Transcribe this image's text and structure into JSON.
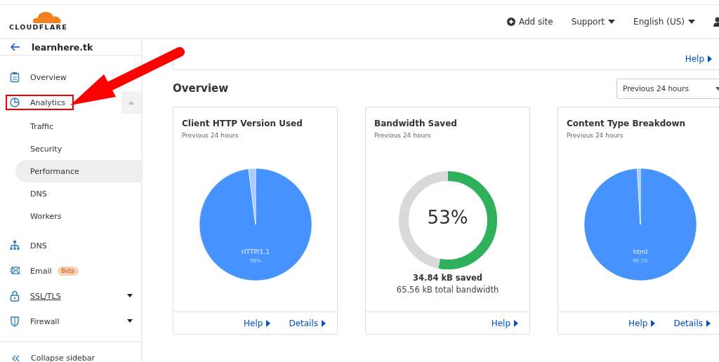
{
  "header": {
    "logo": "CLOUDFLARE",
    "actions": [
      {
        "kind": "add",
        "label": "Add site"
      },
      {
        "kind": "menu",
        "label": "Support"
      },
      {
        "kind": "menu",
        "label": "English (US)"
      },
      {
        "kind": "user"
      }
    ]
  },
  "sidebar": {
    "site": "learnhere.tk",
    "items": [
      {
        "label": "Overview"
      },
      {
        "label": "Analytics",
        "highlighted": true,
        "expanded": true,
        "children": [
          {
            "label": "Traffic",
            "selected": false
          },
          {
            "label": "Security",
            "selected": false
          },
          {
            "label": "Performance",
            "selected": true
          },
          {
            "label": "DNS",
            "selected": false
          },
          {
            "label": "Workers",
            "selected": false
          }
        ]
      },
      {
        "label": "DNS"
      },
      {
        "label": "Email",
        "badge": "Beta"
      },
      {
        "label": "SSL/TLS",
        "hovered": true,
        "expanded": false
      },
      {
        "label": "Firewall",
        "expanded": false
      }
    ],
    "collapse": "Collapse sidebar"
  },
  "main": {
    "top_panel": {
      "help": "Help"
    },
    "title": "Overview",
    "range": {
      "value": "Previous 24 hours"
    },
    "cards": [
      {
        "kind": "pie",
        "title": "Client HTTP Version Used",
        "subtitle": "Previous 24 hours",
        "chart_data": {
          "type": "pie",
          "categories": [
            "HTTP/1.1",
            null
          ],
          "values": [
            98,
            2
          ],
          "value_labels": [
            "98%",
            null
          ]
        },
        "links": [
          "Help",
          "Details"
        ]
      },
      {
        "kind": "meter",
        "title": "Bandwidth Saved",
        "subtitle": "Previous 24 hours",
        "level": 0.53,
        "reading": "53%",
        "saved": "34.84 kB saved",
        "total": "65.56 kB total bandwidth",
        "links": [
          "Help"
        ]
      },
      {
        "kind": "pie",
        "title": "Content Type Breakdown",
        "subtitle": "Previous 24 hours",
        "chart_data": {
          "type": "pie",
          "categories": [
            "html",
            null
          ],
          "values": [
            99.1,
            0.9
          ],
          "value_labels": [
            "99.1%",
            null
          ]
        },
        "links": [
          "Help",
          "Details"
        ]
      }
    ]
  }
}
